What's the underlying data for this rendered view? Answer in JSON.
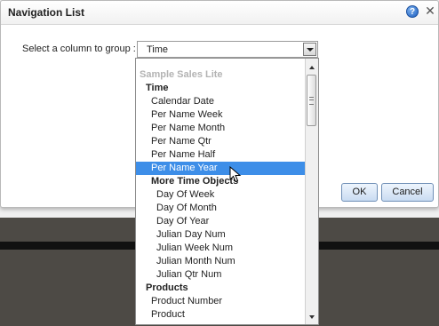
{
  "dialog": {
    "title": "Navigation List",
    "help_glyph": "?",
    "close_glyph": "✕",
    "field_label": "Select a column to group :",
    "select_value": "Time",
    "ok_label": "OK",
    "cancel_label": "Cancel"
  },
  "dropdown": {
    "items": [
      {
        "label": "Sample Sales Lite",
        "kind": "subject"
      },
      {
        "label": "Time",
        "kind": "folder"
      },
      {
        "label": "Calendar Date",
        "kind": "col"
      },
      {
        "label": "Per Name Week",
        "kind": "col"
      },
      {
        "label": "Per Name Month",
        "kind": "col"
      },
      {
        "label": "Per Name Qtr",
        "kind": "col"
      },
      {
        "label": "Per Name Half",
        "kind": "col"
      },
      {
        "label": "Per Name Year",
        "kind": "col",
        "selected": true
      },
      {
        "label": "More Time Objects",
        "kind": "subfolder"
      },
      {
        "label": "Day Of Week",
        "kind": "col2"
      },
      {
        "label": "Day Of Month",
        "kind": "col2"
      },
      {
        "label": "Day Of Year",
        "kind": "col2"
      },
      {
        "label": "Julian Day Num",
        "kind": "col2"
      },
      {
        "label": "Julian Week Num",
        "kind": "col2"
      },
      {
        "label": "Julian Month Num",
        "kind": "col2"
      },
      {
        "label": "Julian Qtr Num",
        "kind": "col2"
      },
      {
        "label": "Products",
        "kind": "folder"
      },
      {
        "label": "Product Number",
        "kind": "col"
      },
      {
        "label": "Product",
        "kind": "col"
      }
    ]
  },
  "colors": {
    "selection": "#3d8ee8",
    "button_border": "#6f8fb6",
    "backdrop": "#4d4a45"
  }
}
